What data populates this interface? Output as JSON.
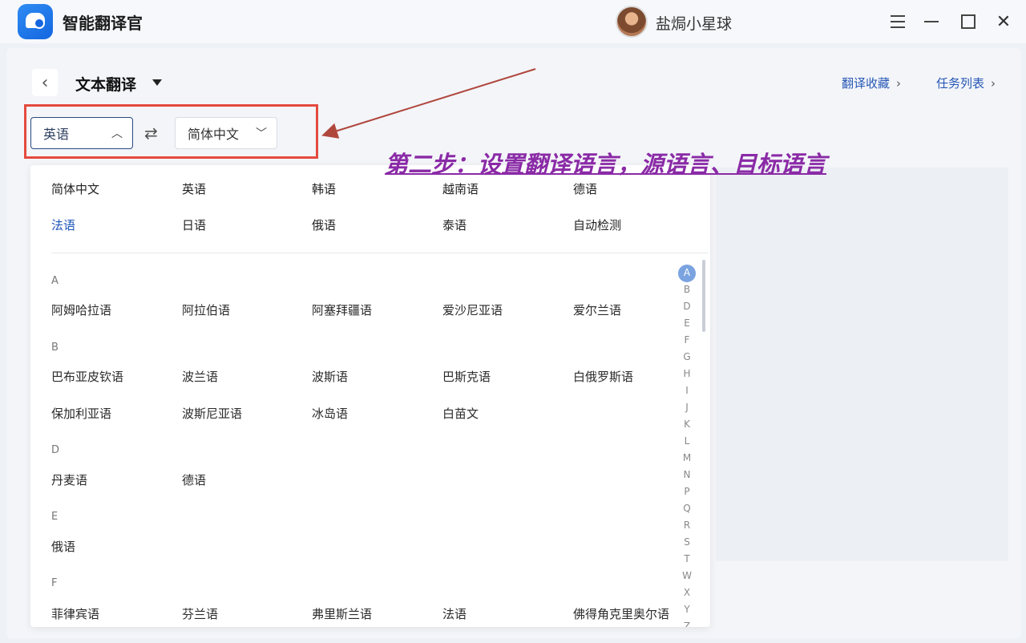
{
  "window": {
    "app_title": "智能翻译官",
    "user_name": "盐焗小星球"
  },
  "header": {
    "mode_title": "文本翻译",
    "links": [
      {
        "label": "翻译收藏"
      },
      {
        "label": "任务列表"
      }
    ]
  },
  "language_bar": {
    "source": "英语",
    "target": "简体中文"
  },
  "annotation_text": "第二步：设置翻译语言，源语言、目标语言",
  "dropdown": {
    "common": [
      "简体中文",
      "英语",
      "韩语",
      "越南语",
      "德语",
      "法语",
      "日语",
      "俄语",
      "泰语",
      "自动检测"
    ],
    "active_common": "法语",
    "sections": [
      {
        "letter": "A",
        "items": [
          "阿姆哈拉语",
          "阿拉伯语",
          "阿塞拜疆语",
          "爱沙尼亚语",
          "爱尔兰语"
        ]
      },
      {
        "letter": "B",
        "items": [
          "巴布亚皮钦语",
          "波兰语",
          "波斯语",
          "巴斯克语",
          "白俄罗斯语",
          "保加利亚语",
          "波斯尼亚语",
          "冰岛语",
          "白苗文"
        ]
      },
      {
        "letter": "D",
        "items": [
          "丹麦语",
          "德语"
        ]
      },
      {
        "letter": "E",
        "items": [
          "俄语"
        ]
      },
      {
        "letter": "F",
        "items": [
          "菲律宾语",
          "芬兰语",
          "弗里斯兰语",
          "法语",
          "佛得角克里奥尔语"
        ]
      }
    ],
    "alphabet": [
      "A",
      "B",
      "D",
      "E",
      "F",
      "G",
      "H",
      "I",
      "J",
      "K",
      "L",
      "M",
      "N",
      "P",
      "Q",
      "R",
      "S",
      "T",
      "W",
      "X",
      "Y",
      "Z"
    ],
    "active_letter": "A"
  },
  "colors": {
    "accent": "#1e55b8",
    "highlight_box": "#e54b3e",
    "annotation": "#8a2aa6"
  }
}
